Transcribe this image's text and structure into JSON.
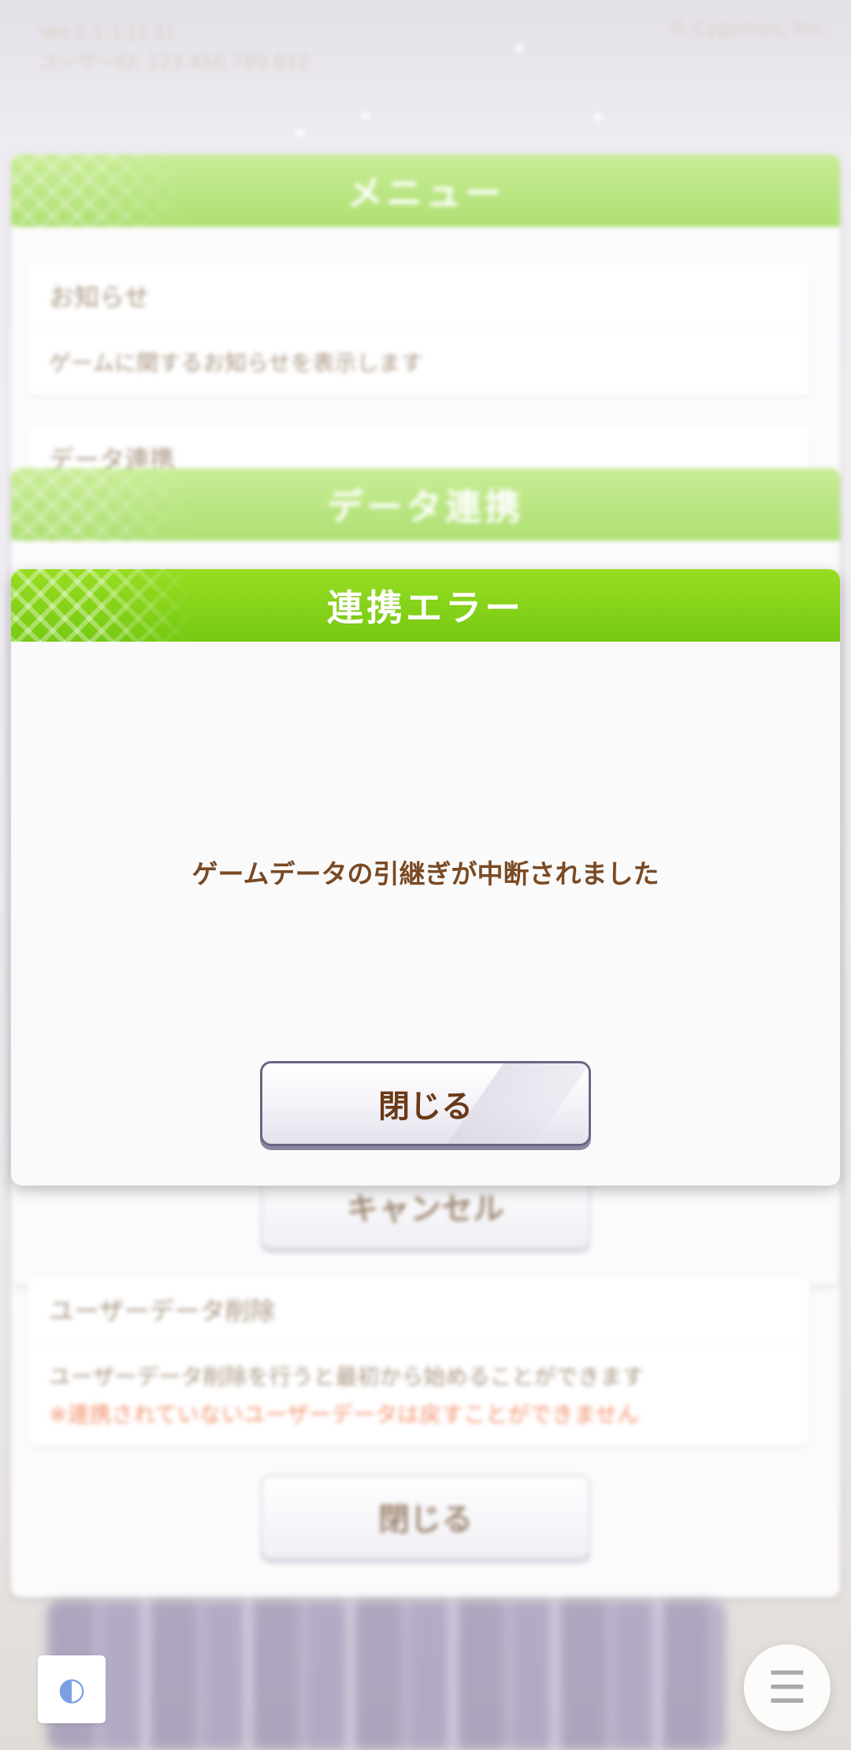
{
  "background": {
    "top_info_line1": "Ver.1.1.1 (1.1)",
    "top_info_line2": "ユーザーID: 123 456 789 012",
    "copyright": "© Cygames, Inc.",
    "menu_panel": {
      "title": "メニュー",
      "cards": [
        {
          "head": "お知らせ",
          "desc": "ゲームに関するお知らせを表示します"
        },
        {
          "head": "データ連携"
        }
      ]
    },
    "data_link_panel": {
      "title": "データ連携",
      "cancel_label": "キャンセル"
    },
    "delete_card": {
      "head": "ユーザーデータ削除",
      "desc": "ユーザーデータ削除を行うと最初から始めることができます",
      "warning": "※連携されていないユーザーデータは戻すことができません"
    },
    "close_label": "閉じる"
  },
  "modal": {
    "title": "連携エラー",
    "message": "ゲームデータの引継ぎが中断されました",
    "close_label": "閉じる"
  },
  "icons": {
    "hamburger": "menu-icon",
    "logo": "app-logo"
  },
  "colors": {
    "header_green": "#8fd43d",
    "modal_header_green": "#76c912",
    "message_brown": "#7a4a24",
    "warning_red": "#f06b3a"
  }
}
